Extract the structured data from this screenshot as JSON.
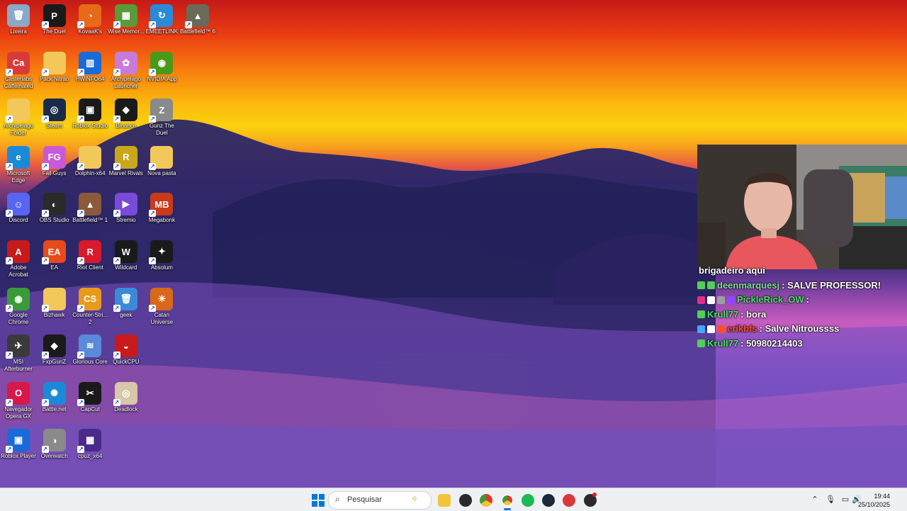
{
  "desktop_icons": [
    {
      "label": "Lixeira",
      "col": 0,
      "row": 0,
      "glyph": "🗑",
      "color": "#8aa8c8"
    },
    {
      "label": "The Duel",
      "col": 1,
      "row": 0,
      "glyph": "P",
      "color": "#1a1a1a"
    },
    {
      "label": "KovaaK's",
      "col": 2,
      "row": 0,
      "glyph": "◔",
      "color": "#e86a18"
    },
    {
      "label": "Wise Memor...",
      "col": 3,
      "row": 0,
      "glyph": "▦",
      "color": "#5a9a3a"
    },
    {
      "label": "EMEETLINK",
      "col": 4,
      "row": 0,
      "glyph": "↻",
      "color": "#2a8ad8"
    },
    {
      "label": "Battlefield™ 6",
      "col": 5,
      "row": 0,
      "glyph": "▲",
      "color": "#6a6a5a"
    },
    {
      "label": "Casterlabs Caffeinated",
      "col": 0,
      "row": 1,
      "glyph": "Ca",
      "color": "#d83a3a"
    },
    {
      "label": "Pack Nitrao",
      "col": 1,
      "row": 1,
      "glyph": "",
      "color": "#f3c85a"
    },
    {
      "label": "HWiNFO64",
      "col": 2,
      "row": 1,
      "glyph": "▥",
      "color": "#1a6ad8"
    },
    {
      "label": "Archipelago Launcher",
      "col": 3,
      "row": 1,
      "glyph": "✿",
      "color": "#c87ad8"
    },
    {
      "label": "NVIDIA App",
      "col": 4,
      "row": 1,
      "glyph": "◉",
      "color": "#4a9a1a"
    },
    {
      "label": "Archipelago Folder",
      "col": 0,
      "row": 2,
      "glyph": "",
      "color": "#f3c85a"
    },
    {
      "label": "Steam",
      "col": 1,
      "row": 2,
      "glyph": "◎",
      "color": "#1a2a4a"
    },
    {
      "label": "Roblox Studio",
      "col": 2,
      "row": 2,
      "glyph": "▣",
      "color": "#1a1a1a"
    },
    {
      "label": "Binance",
      "col": 3,
      "row": 2,
      "glyph": "◆",
      "color": "#1a1a1a"
    },
    {
      "label": "Gunz The Duel",
      "col": 4,
      "row": 2,
      "glyph": "Z",
      "color": "#8a8a8a"
    },
    {
      "label": "Microsoft Edge",
      "col": 0,
      "row": 3,
      "glyph": "e",
      "color": "#1a8ad8"
    },
    {
      "label": "Fall Guys",
      "col": 1,
      "row": 3,
      "glyph": "FG",
      "color": "#c85ad8"
    },
    {
      "label": "Dolphin-x64",
      "col": 2,
      "row": 3,
      "glyph": "",
      "color": "#f3c85a"
    },
    {
      "label": "Marvel Rivals",
      "col": 3,
      "row": 3,
      "glyph": "R",
      "color": "#c8a81a"
    },
    {
      "label": "Nova pasta",
      "col": 4,
      "row": 3,
      "glyph": "",
      "color": "#f3c85a"
    },
    {
      "label": "Discord",
      "col": 0,
      "row": 4,
      "glyph": "☺",
      "color": "#5865f2"
    },
    {
      "label": "OBS Studio",
      "col": 1,
      "row": 4,
      "glyph": "◐",
      "color": "#2a2a2a"
    },
    {
      "label": "Battlefield™ 1",
      "col": 2,
      "row": 4,
      "glyph": "▲",
      "color": "#8a5a3a"
    },
    {
      "label": "Stremio",
      "col": 3,
      "row": 4,
      "glyph": "▶",
      "color": "#7a4ad8"
    },
    {
      "label": "Megabonk",
      "col": 4,
      "row": 4,
      "glyph": "MB",
      "color": "#c83a1a"
    },
    {
      "label": "Adobe Acrobat",
      "col": 0,
      "row": 5,
      "glyph": "A",
      "color": "#c81a1a"
    },
    {
      "label": "EA",
      "col": 1,
      "row": 5,
      "glyph": "EA",
      "color": "#e84a1a"
    },
    {
      "label": "Riot Client",
      "col": 2,
      "row": 5,
      "glyph": "R",
      "color": "#d81a2a"
    },
    {
      "label": "Wildcard",
      "col": 3,
      "row": 5,
      "glyph": "W",
      "color": "#1a1a1a"
    },
    {
      "label": "Absolum",
      "col": 4,
      "row": 5,
      "glyph": "✦",
      "color": "#1a1a1a"
    },
    {
      "label": "Google Chrome",
      "col": 0,
      "row": 6,
      "glyph": "◉",
      "color": "#3a9a3a"
    },
    {
      "label": "Bizhawk",
      "col": 1,
      "row": 6,
      "glyph": "",
      "color": "#f3c85a"
    },
    {
      "label": "Counter-Stri... 2",
      "col": 2,
      "row": 6,
      "glyph": "CS",
      "color": "#e89a1a"
    },
    {
      "label": "geek",
      "col": 3,
      "row": 6,
      "glyph": "🗑",
      "color": "#3a8ad8"
    },
    {
      "label": "Catan Universe",
      "col": 4,
      "row": 6,
      "glyph": "☀",
      "color": "#d8681a"
    },
    {
      "label": "MSI Afterburner",
      "col": 0,
      "row": 7,
      "glyph": "✈",
      "color": "#3a3a3a"
    },
    {
      "label": "FxpGunZ",
      "col": 1,
      "row": 7,
      "glyph": "◆",
      "color": "#1a1a1a"
    },
    {
      "label": "Glorious Core",
      "col": 2,
      "row": 7,
      "glyph": "≋",
      "color": "#5a8ad8"
    },
    {
      "label": "QuickCPU",
      "col": 3,
      "row": 7,
      "glyph": "◒",
      "color": "#c81a1a"
    },
    {
      "label": "Navegador Opera GX",
      "col": 0,
      "row": 8,
      "glyph": "O",
      "color": "#d8184a"
    },
    {
      "label": "Battle.net",
      "col": 1,
      "row": 8,
      "glyph": "✺",
      "color": "#1a8ad8"
    },
    {
      "label": "CapCut",
      "col": 2,
      "row": 8,
      "glyph": "✂",
      "color": "#1a1a1a"
    },
    {
      "label": "Deadlock",
      "col": 3,
      "row": 8,
      "glyph": "◎",
      "color": "#d8c8a8"
    },
    {
      "label": "Roblox Player",
      "col": 0,
      "row": 9,
      "glyph": "▣",
      "color": "#1a6ad8"
    },
    {
      "label": "Overwatch",
      "col": 1,
      "row": 9,
      "glyph": "◑",
      "color": "#8a8a8a"
    },
    {
      "label": "cpuz_x64",
      "col": 2,
      "row": 9,
      "glyph": "▦",
      "color": "#4a2a8a"
    }
  ],
  "chat": {
    "top_partial": "brigadeiro aqui",
    "messages": [
      {
        "user": "deenmarquesj",
        "user_color": "#7ee0a0",
        "text": ": SALVE PROFESSOR!",
        "badges": [
          "#52d053",
          "#52d053"
        ]
      },
      {
        "user": "PickleRick_OW",
        "user_color": "#4be36a",
        "text": ":",
        "badges": [
          "#e0308a",
          "#ffffff",
          "#9aa0a6",
          "#9146ff"
        ]
      },
      {
        "user": "Krull77",
        "user_color": "#4be36a",
        "text": ": bora",
        "badges": [
          "#52d053"
        ]
      },
      {
        "user": "erikbfs",
        "user_color": "#ff4d2a",
        "text": ": Salve Nitroussss",
        "badges": [
          "#4aa3ff",
          "#ffffff",
          "#ff4d2a"
        ]
      },
      {
        "user": "Krull77",
        "user_color": "#4be36a",
        "text": ": 50980214403",
        "badges": [
          "#52d053"
        ]
      }
    ]
  },
  "taskbar": {
    "search_placeholder": "Pesquisar",
    "pinned_apps": [
      "file-explorer",
      "wildcard",
      "google-chrome",
      "chrome-beta",
      "spotify",
      "steam",
      "casterlabs",
      "obs"
    ],
    "time": "19:44",
    "date": "25/10/2025"
  },
  "colors": {
    "taskbar_bg": "#eef0f4",
    "accent": "#0078d4"
  }
}
